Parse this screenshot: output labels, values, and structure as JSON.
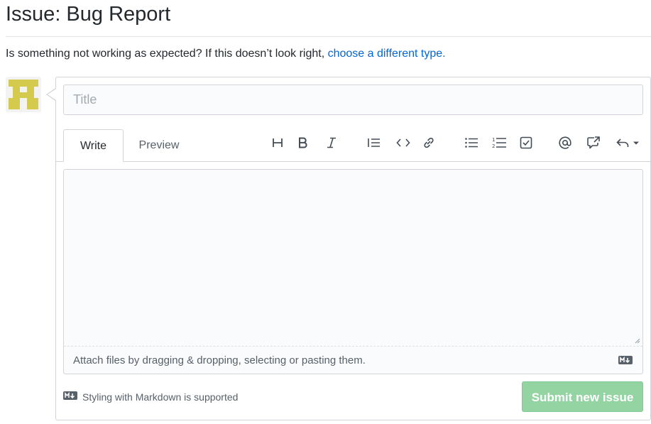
{
  "page": {
    "title": "Issue: Bug Report",
    "intro_text": "Is something not working as expected? If this doesn’t look right, ",
    "intro_link": "choose a different type."
  },
  "form": {
    "title_placeholder": "Title",
    "tabs": [
      {
        "label": "Write",
        "selected": true
      },
      {
        "label": "Preview",
        "selected": false
      }
    ],
    "toolbar": [
      {
        "name": "heading-icon"
      },
      {
        "name": "bold-icon"
      },
      {
        "name": "italic-icon"
      },
      {
        "name": "quote-icon"
      },
      {
        "name": "code-icon"
      },
      {
        "name": "link-icon"
      },
      {
        "name": "unordered-list-icon"
      },
      {
        "name": "ordered-list-icon"
      },
      {
        "name": "task-list-icon"
      },
      {
        "name": "mention-icon"
      },
      {
        "name": "cross-reference-icon"
      },
      {
        "name": "saved-reply-icon"
      }
    ],
    "attach_text": "Attach files by dragging & dropping, selecting or pasting them.",
    "markdown_hint": "Styling with Markdown is supported",
    "submit_label": "Submit new issue",
    "submit_enabled": false
  },
  "colors": {
    "link": "#0366d6",
    "submit_bg": "#94d3a2",
    "avatar_fg": "#d4ca4e"
  }
}
